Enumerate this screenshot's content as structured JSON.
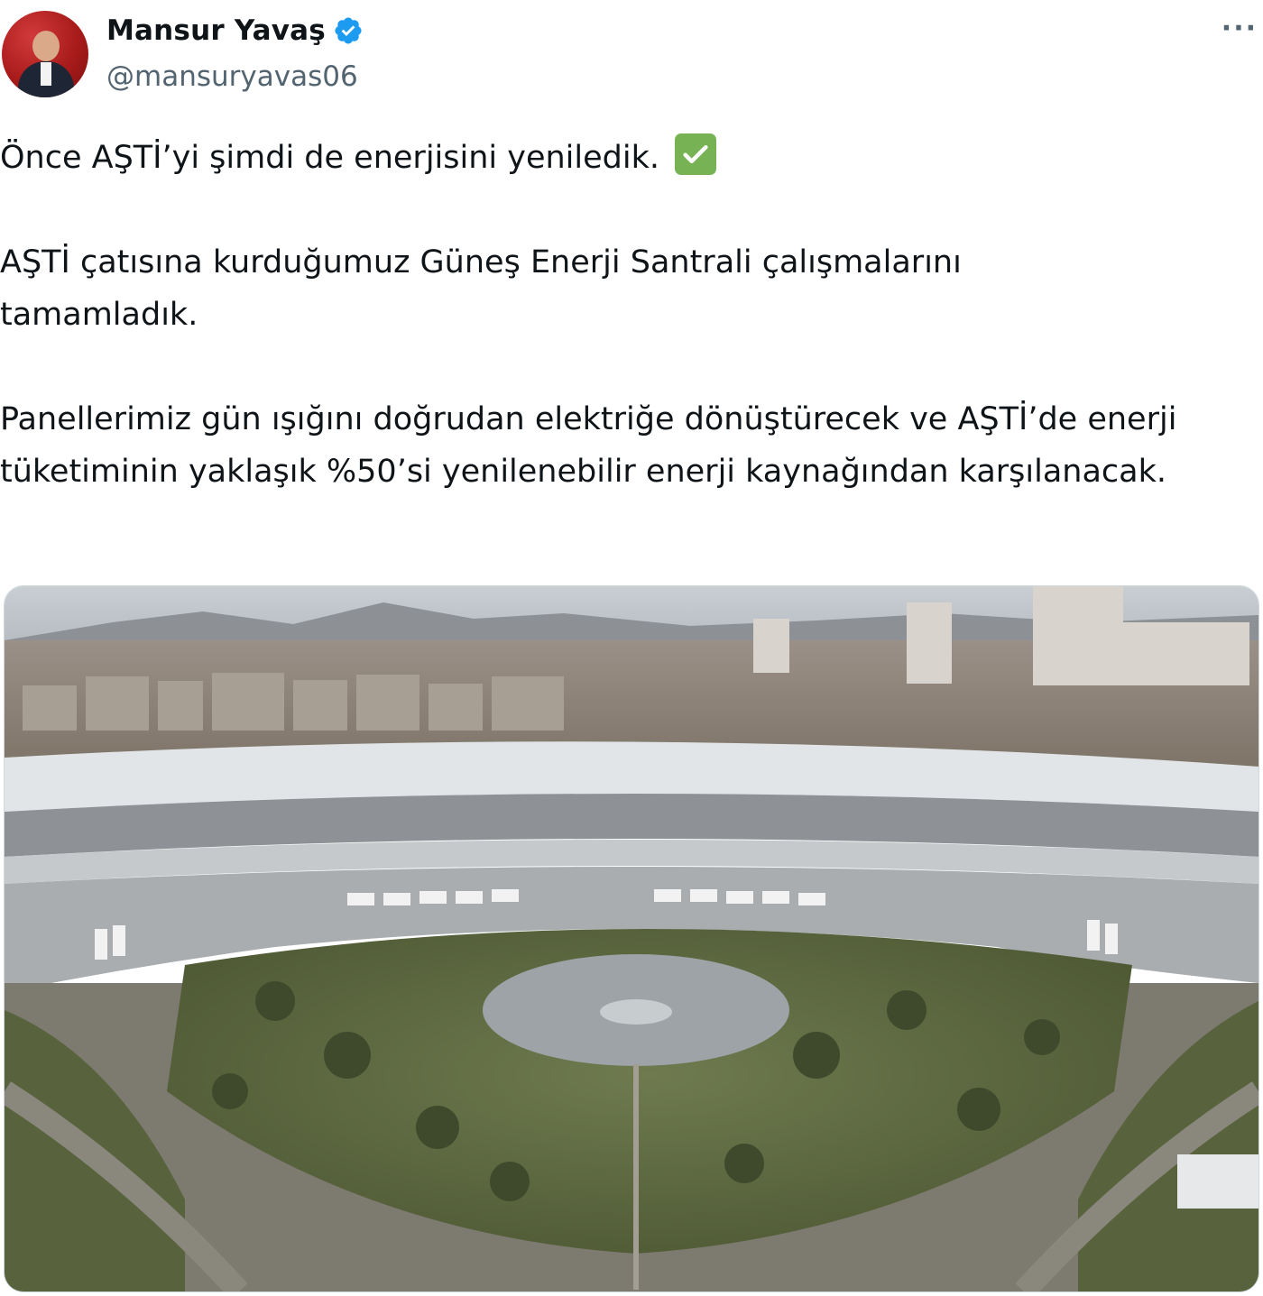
{
  "author": {
    "display_name": "Mansur Yavaş",
    "handle": "@mansuryavas06",
    "verified_icon": "verified-badge-icon",
    "avatar_icon": "profile-avatar"
  },
  "more_button": "···",
  "tweet": {
    "paragraphs": [
      "Önce AŞTİ’yi şimdi de enerjisini yeniledik.",
      "AŞTİ çatısına kurduğumuz Güneş Enerji Santrali çalışmalarını tamamladık.",
      "Panellerimiz gün ışığını doğrudan elektriğe dönüştürecek ve AŞTİ’de enerji tüketiminin yaklaşık %50’si yenilenebilir enerji kaynağından karşılanacak."
    ],
    "emoji": "check-mark-button-emoji"
  },
  "media": {
    "type": "photo",
    "subject": "aerial-photo-bus-terminal"
  },
  "colors": {
    "text": "#0f1419",
    "secondary": "#536471",
    "verified": "#1d9bf0",
    "emoji_green": "#77b255"
  }
}
